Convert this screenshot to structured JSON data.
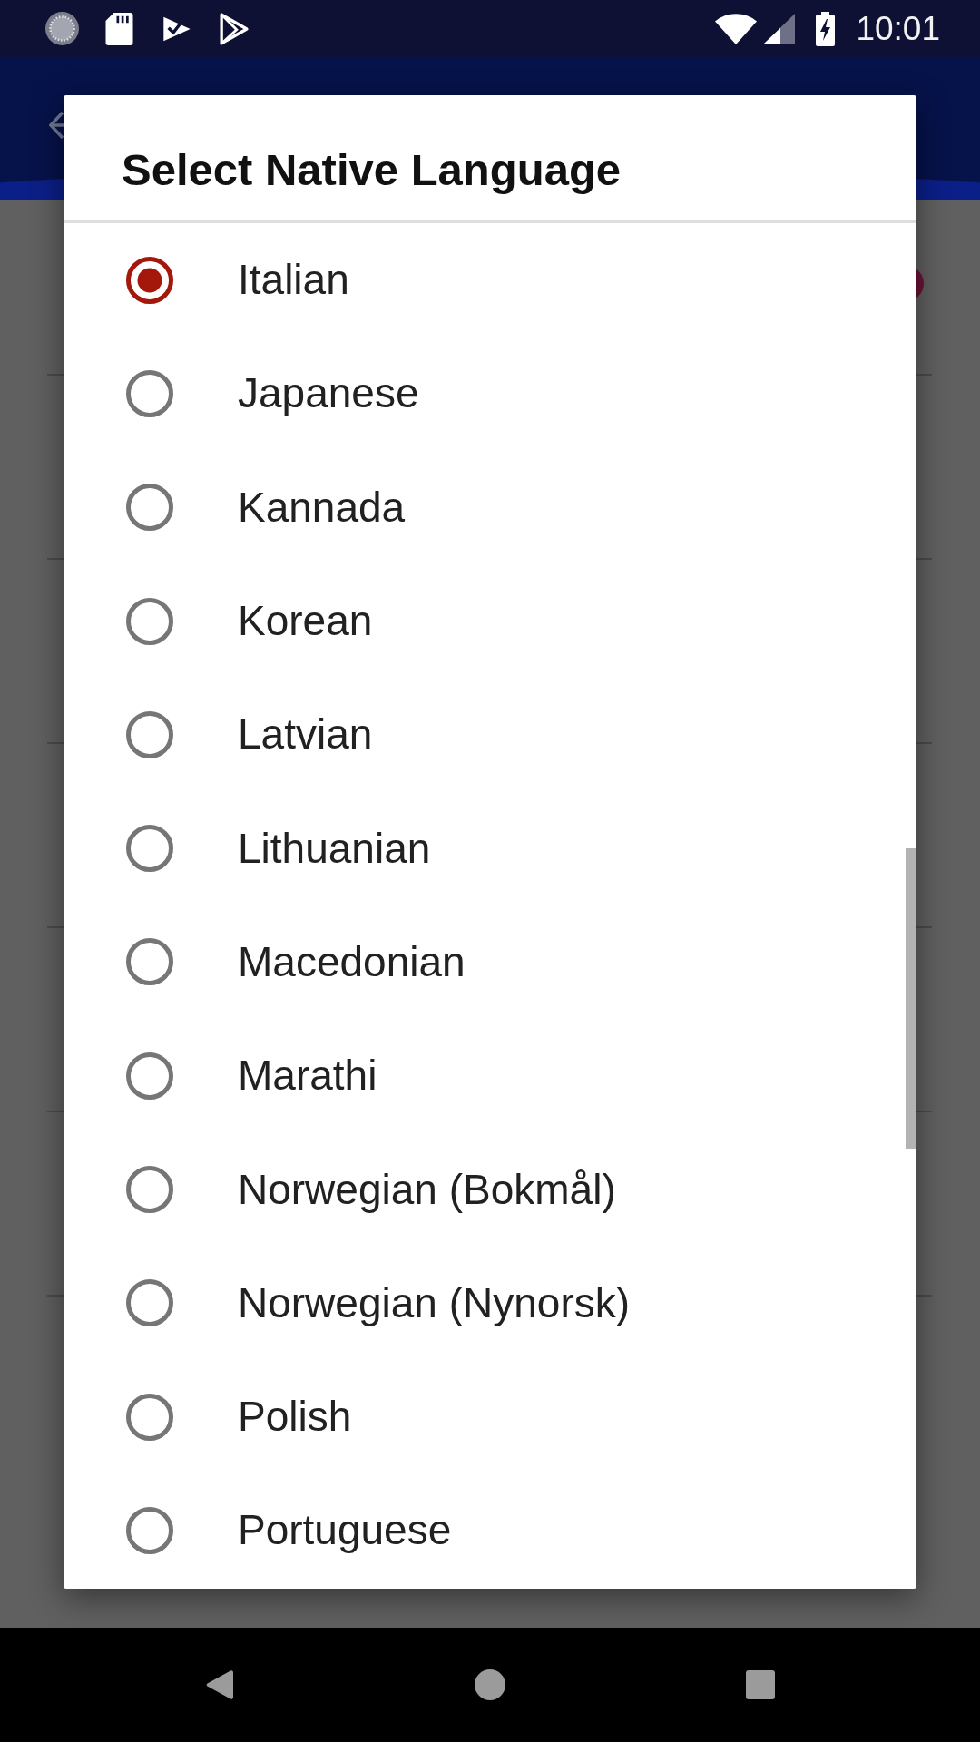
{
  "status_bar": {
    "time": "10:01"
  },
  "dialog": {
    "title": "Select Native Language",
    "options": [
      {
        "label": "Italian",
        "selected": true
      },
      {
        "label": "Japanese",
        "selected": false
      },
      {
        "label": "Kannada",
        "selected": false
      },
      {
        "label": "Korean",
        "selected": false
      },
      {
        "label": "Latvian",
        "selected": false
      },
      {
        "label": "Lithuanian",
        "selected": false
      },
      {
        "label": "Macedonian",
        "selected": false
      },
      {
        "label": "Marathi",
        "selected": false
      },
      {
        "label": "Norwegian (Bokmål)",
        "selected": false
      },
      {
        "label": "Norwegian (Nynorsk)",
        "selected": false
      },
      {
        "label": "Polish",
        "selected": false
      },
      {
        "label": "Portuguese",
        "selected": false
      }
    ]
  }
}
